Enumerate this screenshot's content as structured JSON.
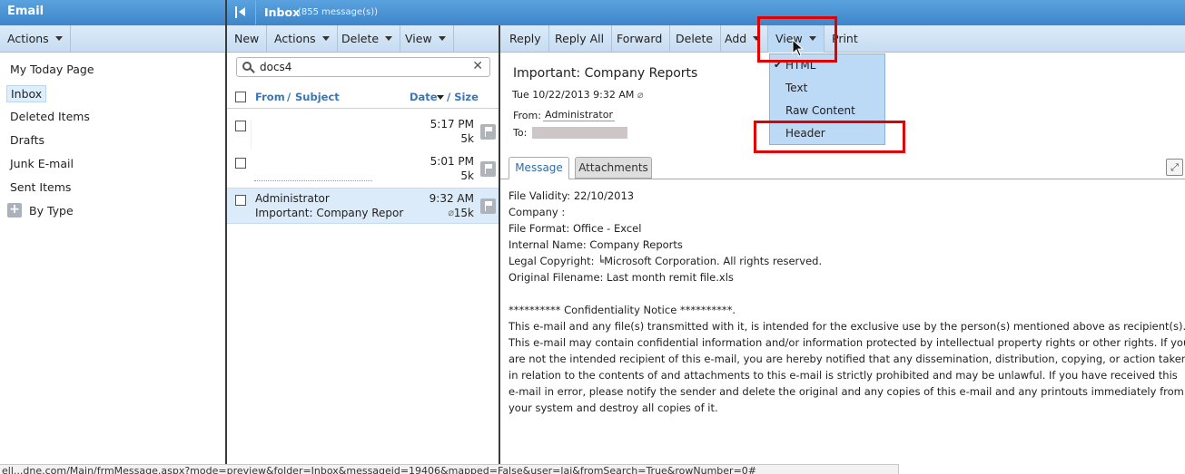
{
  "left": {
    "title": "Email",
    "actions_label": "Actions",
    "folders": [
      "My Today Page",
      "Inbox",
      "Deleted Items",
      "Drafts",
      "Junk E-mail",
      "Sent Items",
      "By Type"
    ]
  },
  "inbox": {
    "title": "Inbox",
    "count": "(855 message(s))"
  },
  "middle": {
    "toolbar": [
      "New",
      "Actions",
      "Delete",
      "View"
    ],
    "search_value": "docs4",
    "col_from": "From",
    "col_sep": "/",
    "col_subject": "Subject",
    "col_date": "Date",
    "col_size": "/ Size",
    "messages": [
      {
        "from": "",
        "subject": "",
        "time": "5:17 PM",
        "size": "5k"
      },
      {
        "from": "",
        "subject": "",
        "time": "5:01 PM",
        "size": "5k"
      },
      {
        "from": "Administrator",
        "subject": "Important: Company Repor",
        "time": "9:32 AM",
        "size": "15k"
      }
    ]
  },
  "reader": {
    "toolbar": [
      "Reply",
      "Reply All",
      "Forward",
      "Delete",
      "Add",
      "View",
      "Print"
    ],
    "subject": "Important: Company Reports",
    "date": "Tue 10/22/2013 9:32 AM",
    "from_label": "From:",
    "from_value": "Administrator",
    "to_label": "To:",
    "tabs": [
      "Message",
      "Attachments"
    ],
    "body_lines": [
      "File Validity: 22/10/2013",
      "Company :",
      "File Format: Office - Excel",
      "Internal Name: Company Reports",
      "Legal Copyright: ╘Microsoft Corporation. All rights reserved.",
      "Original Filename: Last month remit file.xls",
      "",
      "********** Confidentiality Notice **********.",
      "This e-mail and any file(s) transmitted with it, is intended for the exclusive use by the person(s) mentioned above as recipient(s).",
      "This e-mail may contain confidential information and/or information protected by intellectual property rights or other rights. If you",
      "are not the intended recipient of this e-mail, you are hereby notified that any dissemination, distribution, copying, or action taken",
      "in relation to the contents of and attachments to this e-mail is strictly prohibited and may be unlawful. If you have received this",
      "e-mail in error, please notify the sender and delete the original and any copies of this e-mail and any printouts immediately from",
      "your system and destroy all copies of it."
    ]
  },
  "view_menu": {
    "items": [
      "HTML",
      "Text",
      "Raw Content",
      "Header"
    ],
    "checked": "HTML"
  },
  "status_url": "ell...dne.com/Main/frmMessage.aspx?mode=preview&folder=Inbox&messageid=19406&mapped=False&user=lai&fromSearch=True&rowNumber=0#",
  "colors": {
    "title_blue": "#4a93d4",
    "toolbar_blue": "#cfe2f5",
    "menu_bg": "#bcd9f6",
    "highlight_red": "#e00000"
  }
}
